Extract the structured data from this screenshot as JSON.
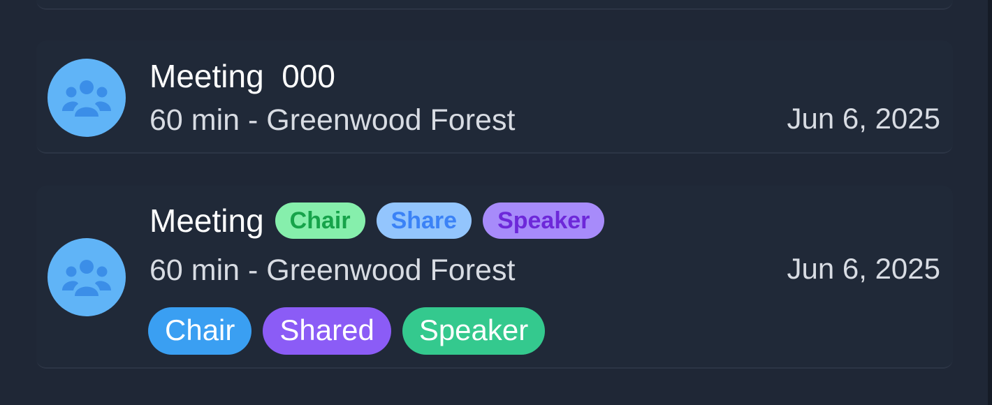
{
  "colors": {
    "background": "#1f2736",
    "avatar": "#60b4f7",
    "chair_light": "#86efac",
    "share_light": "#93c5fd",
    "speaker_light": "#a78bfa",
    "chair": "#3a9ff2",
    "shared": "#8b5cf6",
    "speaker": "#34c98e"
  },
  "meetings": [
    {
      "icon": "people-group-icon",
      "title": "Meeting  000",
      "subtitle": "60 min - Greenwood Forest",
      "date": "Jun 6, 2025"
    },
    {
      "icon": "people-group-icon",
      "title": "Meeting",
      "role_pills": [
        "Chair",
        "Share",
        "Speaker"
      ],
      "subtitle": "60 min - Greenwood Forest",
      "date": "Jun 6, 2025",
      "tags": [
        "Chair",
        "Shared",
        "Speaker"
      ]
    }
  ]
}
